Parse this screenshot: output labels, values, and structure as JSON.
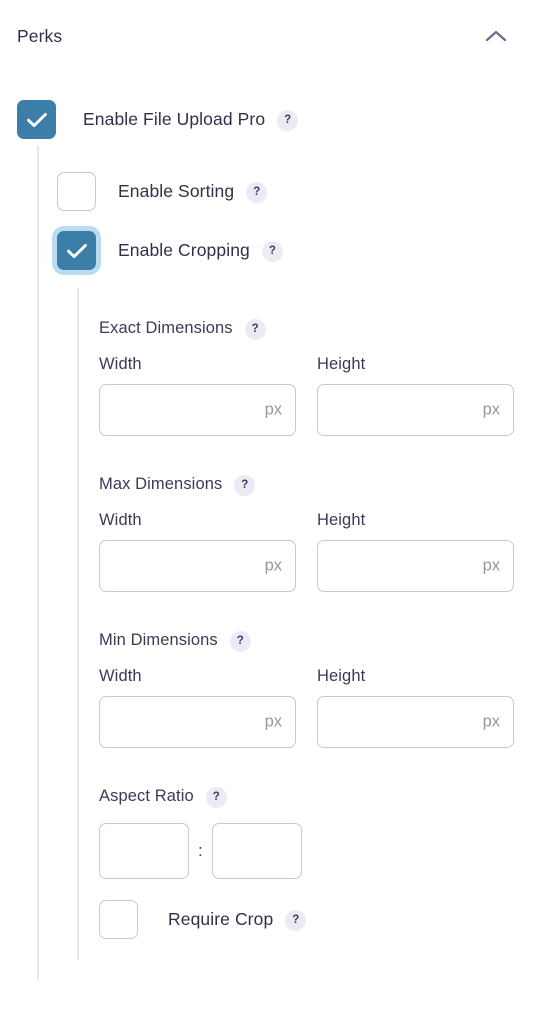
{
  "header": {
    "title": "Perks",
    "collapse_icon": "chevron-up-icon"
  },
  "help_glyph": "?",
  "units": {
    "px": "px"
  },
  "ratio": {
    "separator": ":"
  },
  "toggles": {
    "file_upload_pro": {
      "label": "Enable File Upload Pro",
      "checked": true,
      "focused": false
    },
    "sorting": {
      "label": "Enable Sorting",
      "checked": false,
      "focused": false
    },
    "cropping": {
      "label": "Enable Cropping",
      "checked": true,
      "focused": true
    },
    "require_crop": {
      "label": "Require Crop",
      "checked": false,
      "focused": false
    }
  },
  "groups": {
    "exact": {
      "title": "Exact Dimensions",
      "width_label": "Width",
      "height_label": "Height",
      "width_value": "",
      "height_value": ""
    },
    "max": {
      "title": "Max Dimensions",
      "width_label": "Width",
      "height_label": "Height",
      "width_value": "",
      "height_value": ""
    },
    "min": {
      "title": "Min Dimensions",
      "width_label": "Width",
      "height_label": "Height",
      "width_value": "",
      "height_value": ""
    },
    "aspect": {
      "title": "Aspect Ratio",
      "first_value": "",
      "second_value": ""
    }
  },
  "colors": {
    "accent": "#3b7ea8",
    "focus_ring": "#b9dcf0",
    "text": "#2f3148",
    "border": "#c9c6dd",
    "guide": "#e7e6f2",
    "help_bg": "#ecebf5",
    "unit_text": "#97979f"
  }
}
